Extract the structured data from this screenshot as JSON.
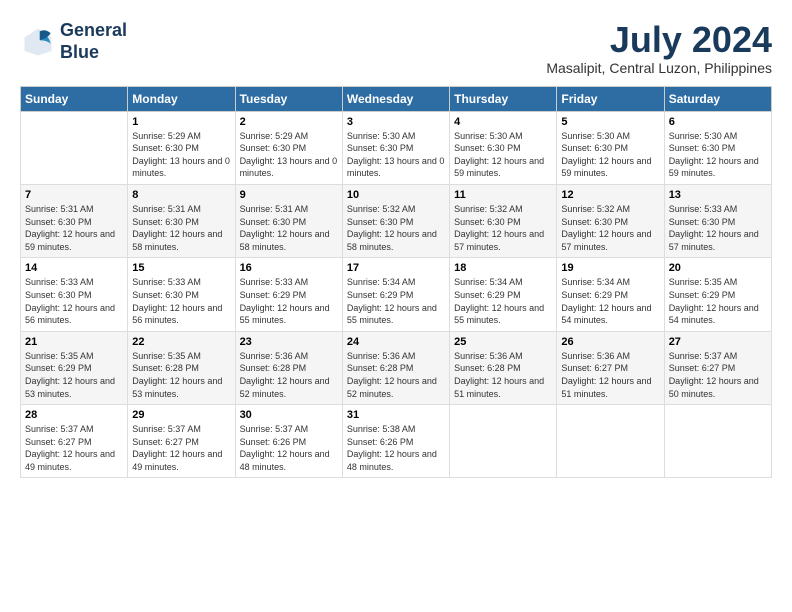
{
  "header": {
    "logo_line1": "General",
    "logo_line2": "Blue",
    "month_year": "July 2024",
    "location": "Masalipit, Central Luzon, Philippines"
  },
  "weekdays": [
    "Sunday",
    "Monday",
    "Tuesday",
    "Wednesday",
    "Thursday",
    "Friday",
    "Saturday"
  ],
  "weeks": [
    [
      {
        "day": "",
        "sunrise": "",
        "sunset": "",
        "daylight": ""
      },
      {
        "day": "1",
        "sunrise": "Sunrise: 5:29 AM",
        "sunset": "Sunset: 6:30 PM",
        "daylight": "Daylight: 13 hours and 0 minutes."
      },
      {
        "day": "2",
        "sunrise": "Sunrise: 5:29 AM",
        "sunset": "Sunset: 6:30 PM",
        "daylight": "Daylight: 13 hours and 0 minutes."
      },
      {
        "day": "3",
        "sunrise": "Sunrise: 5:30 AM",
        "sunset": "Sunset: 6:30 PM",
        "daylight": "Daylight: 13 hours and 0 minutes."
      },
      {
        "day": "4",
        "sunrise": "Sunrise: 5:30 AM",
        "sunset": "Sunset: 6:30 PM",
        "daylight": "Daylight: 12 hours and 59 minutes."
      },
      {
        "day": "5",
        "sunrise": "Sunrise: 5:30 AM",
        "sunset": "Sunset: 6:30 PM",
        "daylight": "Daylight: 12 hours and 59 minutes."
      },
      {
        "day": "6",
        "sunrise": "Sunrise: 5:30 AM",
        "sunset": "Sunset: 6:30 PM",
        "daylight": "Daylight: 12 hours and 59 minutes."
      }
    ],
    [
      {
        "day": "7",
        "sunrise": "Sunrise: 5:31 AM",
        "sunset": "Sunset: 6:30 PM",
        "daylight": "Daylight: 12 hours and 59 minutes."
      },
      {
        "day": "8",
        "sunrise": "Sunrise: 5:31 AM",
        "sunset": "Sunset: 6:30 PM",
        "daylight": "Daylight: 12 hours and 58 minutes."
      },
      {
        "day": "9",
        "sunrise": "Sunrise: 5:31 AM",
        "sunset": "Sunset: 6:30 PM",
        "daylight": "Daylight: 12 hours and 58 minutes."
      },
      {
        "day": "10",
        "sunrise": "Sunrise: 5:32 AM",
        "sunset": "Sunset: 6:30 PM",
        "daylight": "Daylight: 12 hours and 58 minutes."
      },
      {
        "day": "11",
        "sunrise": "Sunrise: 5:32 AM",
        "sunset": "Sunset: 6:30 PM",
        "daylight": "Daylight: 12 hours and 57 minutes."
      },
      {
        "day": "12",
        "sunrise": "Sunrise: 5:32 AM",
        "sunset": "Sunset: 6:30 PM",
        "daylight": "Daylight: 12 hours and 57 minutes."
      },
      {
        "day": "13",
        "sunrise": "Sunrise: 5:33 AM",
        "sunset": "Sunset: 6:30 PM",
        "daylight": "Daylight: 12 hours and 57 minutes."
      }
    ],
    [
      {
        "day": "14",
        "sunrise": "Sunrise: 5:33 AM",
        "sunset": "Sunset: 6:30 PM",
        "daylight": "Daylight: 12 hours and 56 minutes."
      },
      {
        "day": "15",
        "sunrise": "Sunrise: 5:33 AM",
        "sunset": "Sunset: 6:30 PM",
        "daylight": "Daylight: 12 hours and 56 minutes."
      },
      {
        "day": "16",
        "sunrise": "Sunrise: 5:33 AM",
        "sunset": "Sunset: 6:29 PM",
        "daylight": "Daylight: 12 hours and 55 minutes."
      },
      {
        "day": "17",
        "sunrise": "Sunrise: 5:34 AM",
        "sunset": "Sunset: 6:29 PM",
        "daylight": "Daylight: 12 hours and 55 minutes."
      },
      {
        "day": "18",
        "sunrise": "Sunrise: 5:34 AM",
        "sunset": "Sunset: 6:29 PM",
        "daylight": "Daylight: 12 hours and 55 minutes."
      },
      {
        "day": "19",
        "sunrise": "Sunrise: 5:34 AM",
        "sunset": "Sunset: 6:29 PM",
        "daylight": "Daylight: 12 hours and 54 minutes."
      },
      {
        "day": "20",
        "sunrise": "Sunrise: 5:35 AM",
        "sunset": "Sunset: 6:29 PM",
        "daylight": "Daylight: 12 hours and 54 minutes."
      }
    ],
    [
      {
        "day": "21",
        "sunrise": "Sunrise: 5:35 AM",
        "sunset": "Sunset: 6:29 PM",
        "daylight": "Daylight: 12 hours and 53 minutes."
      },
      {
        "day": "22",
        "sunrise": "Sunrise: 5:35 AM",
        "sunset": "Sunset: 6:28 PM",
        "daylight": "Daylight: 12 hours and 53 minutes."
      },
      {
        "day": "23",
        "sunrise": "Sunrise: 5:36 AM",
        "sunset": "Sunset: 6:28 PM",
        "daylight": "Daylight: 12 hours and 52 minutes."
      },
      {
        "day": "24",
        "sunrise": "Sunrise: 5:36 AM",
        "sunset": "Sunset: 6:28 PM",
        "daylight": "Daylight: 12 hours and 52 minutes."
      },
      {
        "day": "25",
        "sunrise": "Sunrise: 5:36 AM",
        "sunset": "Sunset: 6:28 PM",
        "daylight": "Daylight: 12 hours and 51 minutes."
      },
      {
        "day": "26",
        "sunrise": "Sunrise: 5:36 AM",
        "sunset": "Sunset: 6:27 PM",
        "daylight": "Daylight: 12 hours and 51 minutes."
      },
      {
        "day": "27",
        "sunrise": "Sunrise: 5:37 AM",
        "sunset": "Sunset: 6:27 PM",
        "daylight": "Daylight: 12 hours and 50 minutes."
      }
    ],
    [
      {
        "day": "28",
        "sunrise": "Sunrise: 5:37 AM",
        "sunset": "Sunset: 6:27 PM",
        "daylight": "Daylight: 12 hours and 49 minutes."
      },
      {
        "day": "29",
        "sunrise": "Sunrise: 5:37 AM",
        "sunset": "Sunset: 6:27 PM",
        "daylight": "Daylight: 12 hours and 49 minutes."
      },
      {
        "day": "30",
        "sunrise": "Sunrise: 5:37 AM",
        "sunset": "Sunset: 6:26 PM",
        "daylight": "Daylight: 12 hours and 48 minutes."
      },
      {
        "day": "31",
        "sunrise": "Sunrise: 5:38 AM",
        "sunset": "Sunset: 6:26 PM",
        "daylight": "Daylight: 12 hours and 48 minutes."
      },
      {
        "day": "",
        "sunrise": "",
        "sunset": "",
        "daylight": ""
      },
      {
        "day": "",
        "sunrise": "",
        "sunset": "",
        "daylight": ""
      },
      {
        "day": "",
        "sunrise": "",
        "sunset": "",
        "daylight": ""
      }
    ]
  ]
}
